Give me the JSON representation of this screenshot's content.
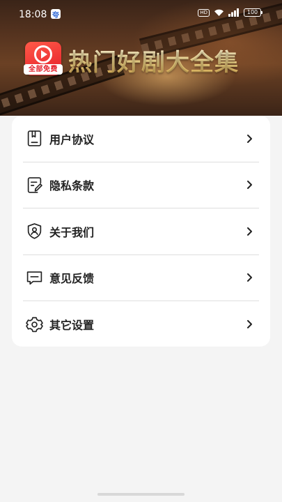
{
  "status_bar": {
    "time": "18:08",
    "app_icon_glyph": "夸",
    "network_badge": "HD",
    "battery_level": "100",
    "icons": [
      "hd-icon",
      "wifi-icon",
      "signal-icon",
      "battery-icon"
    ]
  },
  "banner": {
    "app_logo_caption": "全部免费",
    "title": "热门好剧大全集"
  },
  "menu": {
    "items": [
      {
        "label": "用户协议",
        "icon": "document-icon"
      },
      {
        "label": "隐私条款",
        "icon": "edit-document-icon"
      },
      {
        "label": "关于我们",
        "icon": "shield-user-icon"
      },
      {
        "label": "意见反馈",
        "icon": "message-icon"
      },
      {
        "label": "其它设置",
        "icon": "gear-icon"
      }
    ]
  },
  "colors": {
    "accent_red": "#e51e2a",
    "title_gold": "#f5d98a",
    "text_primary": "#222222",
    "background": "#f4f4f4",
    "divider": "#dedede"
  }
}
